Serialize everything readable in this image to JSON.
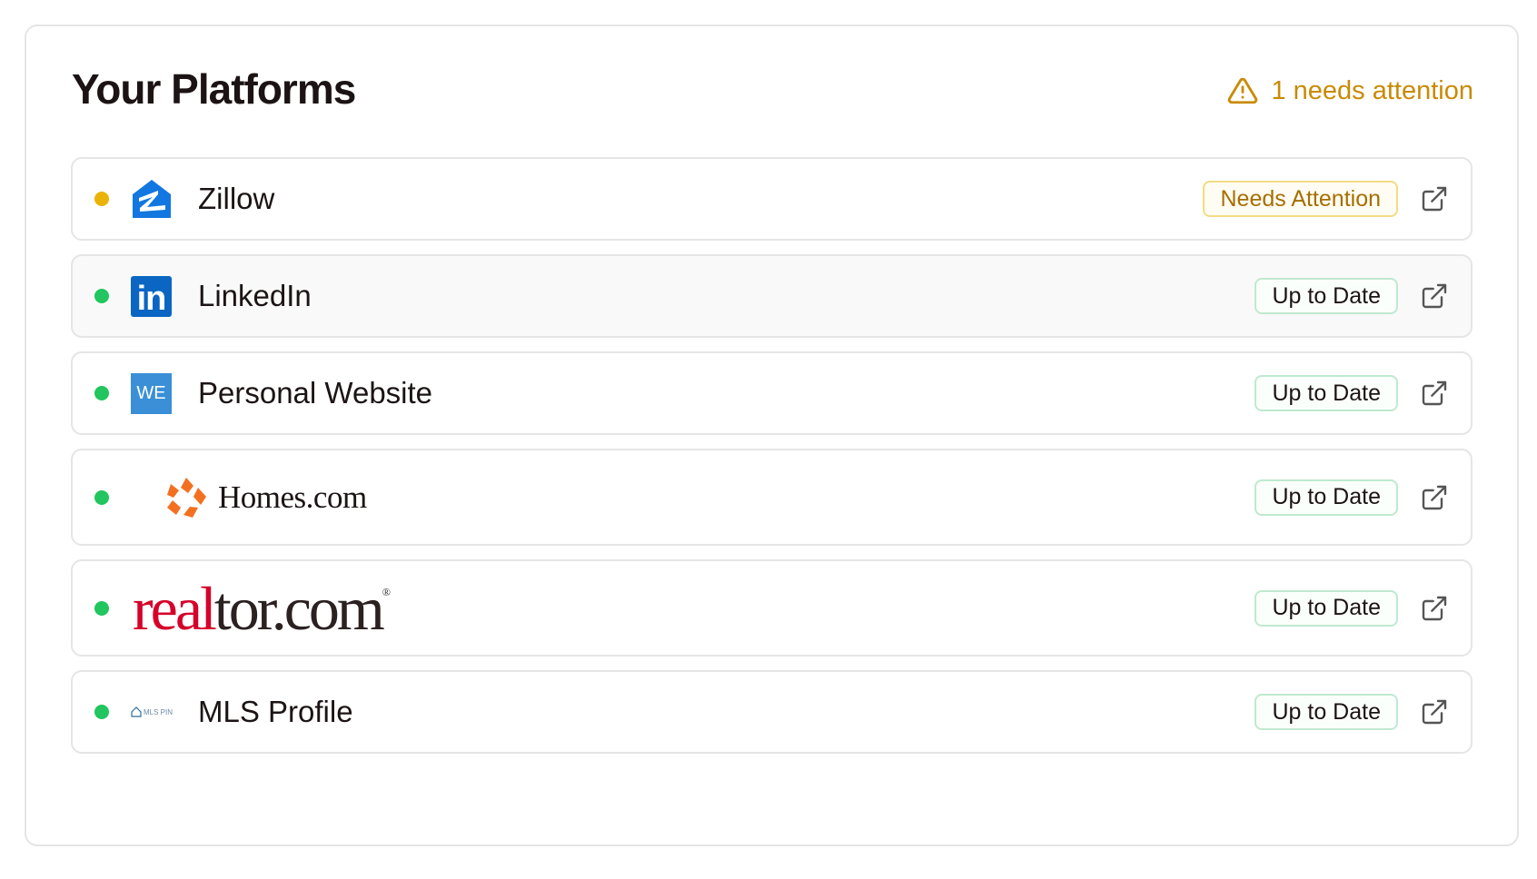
{
  "card": {
    "title": "Your Platforms",
    "attention_text": "1 needs attention",
    "colors": {
      "warning": "#c98a06",
      "ok": "#22c55e",
      "pending": "#eab308"
    }
  },
  "platforms": [
    {
      "name": "Zillow",
      "status": "Needs Attention",
      "dot": "pending",
      "logo": "zillow-logo"
    },
    {
      "name": "LinkedIn",
      "status": "Up to Date",
      "dot": "ok",
      "logo": "linkedin-logo",
      "logo_text": "in"
    },
    {
      "name": "Personal Website",
      "status": "Up to Date",
      "dot": "ok",
      "logo": "website-logo",
      "logo_text": "WE"
    },
    {
      "name": "",
      "status": "Up to Date",
      "dot": "ok",
      "logo": "homes-com-logo",
      "logo_text": "Homes.com"
    },
    {
      "name": "",
      "status": "Up to Date",
      "dot": "ok",
      "logo": "realtor-com-logo",
      "logo_text_red": "real",
      "logo_text_dark": "tor.com"
    },
    {
      "name": "MLS Profile",
      "status": "Up to Date",
      "dot": "ok",
      "logo": "mls-pin-logo",
      "logo_text": "MLS PIN"
    }
  ]
}
